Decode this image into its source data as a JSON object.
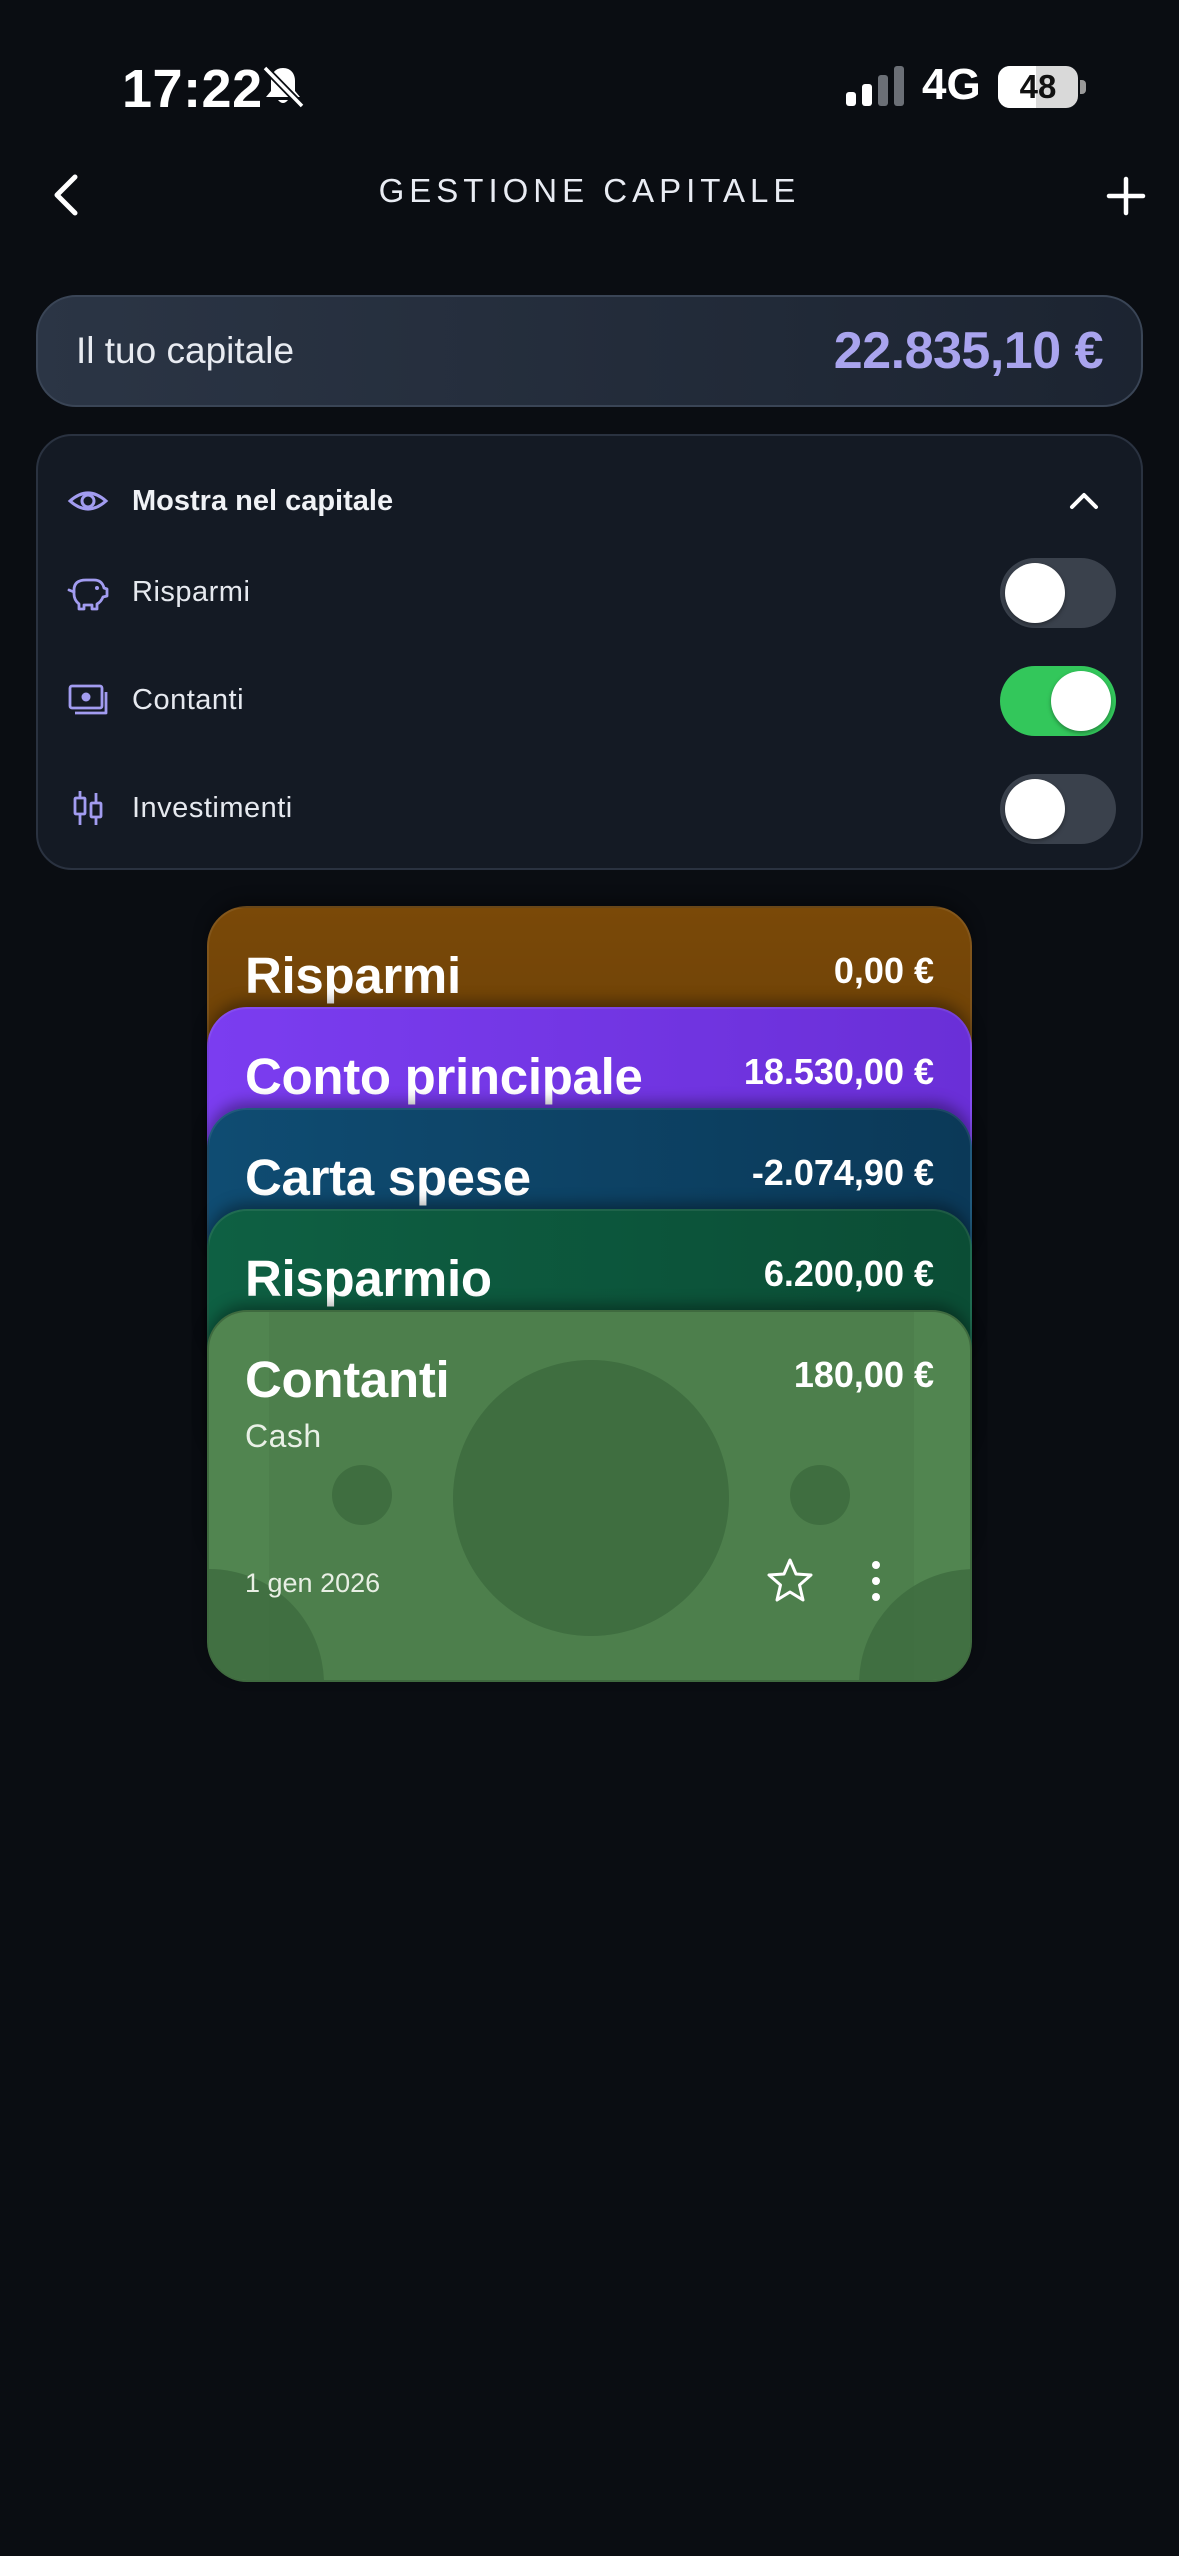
{
  "status_bar": {
    "time": "17:22",
    "network": "4G",
    "battery": "48",
    "battery_level": 0.48
  },
  "header": {
    "title": "GESTIONE CAPITALE",
    "icons": {
      "back": "chevron-left-icon",
      "add": "plus-icon"
    }
  },
  "capital": {
    "label": "Il tuo capitale",
    "value": "22.835,10 €",
    "value_color": "#a9a4ee"
  },
  "settings": {
    "title": "Mostra nel capitale",
    "title_icon": "eye-icon",
    "expanded": true,
    "items": [
      {
        "label": "Risparmi",
        "icon": "piggy-bank-icon",
        "enabled": false
      },
      {
        "label": "Contanti",
        "icon": "cash-icon",
        "enabled": true
      },
      {
        "label": "Investimenti",
        "icon": "candlestick-icon",
        "enabled": false
      }
    ],
    "toggle_on_color": "#33c75b"
  },
  "cards": [
    {
      "name": "Risparmi",
      "amount": "0,00 €",
      "color": "#7a4908"
    },
    {
      "name": "Conto principale",
      "amount": "18.530,00 €",
      "color": "#7b3df0"
    },
    {
      "name": "Carta spese",
      "amount": "-2.074,90 €",
      "color": "#0f4c72"
    },
    {
      "name": "Risparmio",
      "amount": "6.200,00 €",
      "color": "#0e6043"
    },
    {
      "name": "Contanti",
      "subtitle": "Cash",
      "amount": "180,00 €",
      "date": "1 gen 2026",
      "color": "#518550"
    }
  ]
}
